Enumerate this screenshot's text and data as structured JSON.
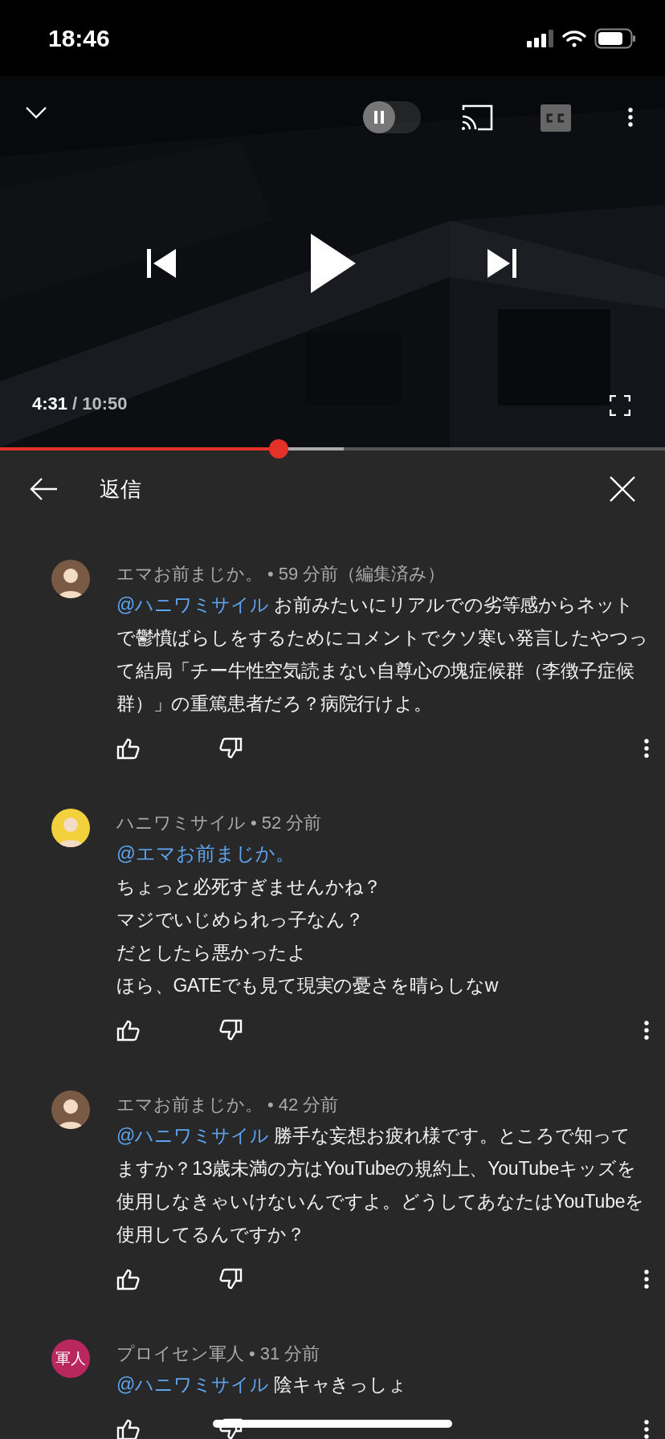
{
  "status_bar": {
    "time": "18:46"
  },
  "player": {
    "autoplay": {
      "on": false
    },
    "current_time": "4:31",
    "duration": "/ 10:50",
    "progress": {
      "level": 0.419,
      "buffer": {
        "level": 0.517
      }
    }
  },
  "panel": {
    "title": "返信"
  },
  "comments": [
    {
      "avatar": {
        "kind": "figure",
        "color": "#7a5a45"
      },
      "author": "エマお前まじか。",
      "time": "• 59 分前（編集済み）",
      "mention": "@ハニワミサイル",
      "body": " お前みたいにリアルでの劣等感からネットで鬱憤ばらしをするためにコメントでクソ寒い発言したやつって結局「チー牛性空気読まない自尊心の塊症候群（李徴子症候群）」の重篤患者だろ？病院行けよ。"
    },
    {
      "avatar": {
        "kind": "figure",
        "color": "#f2d13c"
      },
      "author": "ハニワミサイル",
      "time": "• 52 分前",
      "mention": "@エマお前まじか。",
      "lines": [
        "ちょっと必死すぎませんかね？",
        "マジでいじめられっ子なん？",
        "だとしたら悪かったよ",
        "ほら、GATEでも見て現実の憂さを晴らしなw"
      ]
    },
    {
      "avatar": {
        "kind": "figure",
        "color": "#7a5a45"
      },
      "author": "エマお前まじか。",
      "time": "• 42 分前",
      "mention": "@ハニワミサイル",
      "body": " 勝手な妄想お疲れ様です。ところで知ってますか？13歳未満の方はYouTubeの規約上、YouTubeキッズを使用しなきゃいけないんですよ。どうしてあなたはYouTubeを使用してるんですか？"
    },
    {
      "avatar": {
        "kind": "text",
        "color": "#b8285c",
        "text": "軍人"
      },
      "author": "プロイセン軍人",
      "time": "• 31 分前",
      "mention": "@ハニワミサイル",
      "body": " 陰キャきっしょ"
    }
  ]
}
